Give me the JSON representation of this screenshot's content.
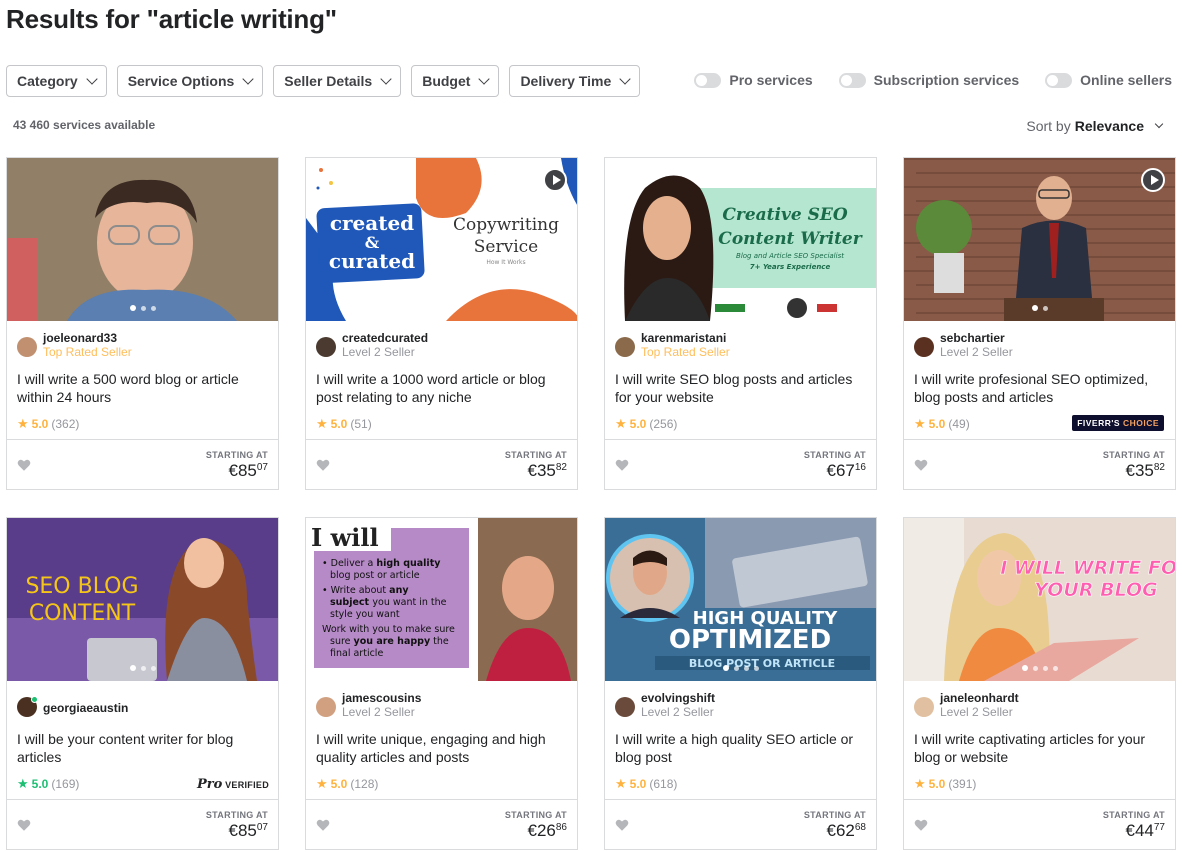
{
  "page": {
    "title": "Results for \"article writing\"",
    "count": "43 460 services available",
    "sort_label": "Sort by",
    "sort_value": "Relevance"
  },
  "filters": [
    "Category",
    "Service Options",
    "Seller Details",
    "Budget",
    "Delivery Time"
  ],
  "toggles": [
    "Pro services",
    "Subscription services",
    "Online sellers"
  ],
  "labels": {
    "starting_at": "STARTING AT",
    "currency": "€"
  },
  "gigs": [
    {
      "seller": "joeleonard33",
      "level": "Top Rated Seller",
      "level_type": "top",
      "title": "I will write a 500 word blog or article within 24 hours",
      "rating": "5.0",
      "reviews": "(362)",
      "price_main": "85",
      "price_cents": "07",
      "dots": 3,
      "active_dot": 0,
      "video": false,
      "badge": "",
      "thumb": {
        "bg": "#7a6a55",
        "accent": "#5a7fb0"
      }
    },
    {
      "seller": "createdcurated",
      "level": "Level 2 Seller",
      "level_type": "normal",
      "title": "I will write a 1000 word article or blog post relating to any niche",
      "rating": "5.0",
      "reviews": "(51)",
      "price_main": "35",
      "price_cents": "82",
      "dots": 3,
      "active_dot": 0,
      "video": true,
      "badge": "",
      "thumb": {
        "bg": "#ffffff",
        "accent": "#1f58b8",
        "text1": "created",
        "text2": "&",
        "text3": "curated",
        "text4": "Copywriting",
        "text5": "Service",
        "text6": "How It Works"
      }
    },
    {
      "seller": "karenmaristani",
      "level": "Top Rated Seller",
      "level_type": "top",
      "title": "I will write SEO blog posts and articles for your website",
      "rating": "5.0",
      "reviews": "(256)",
      "price_main": "67",
      "price_cents": "16",
      "dots": 0,
      "active_dot": 0,
      "video": false,
      "badge": "",
      "thumb": {
        "bg": "#b5e6cf",
        "accent": "#1a6b4a",
        "text1": "Creative SEO",
        "text2": "Content Writer",
        "text3": "Blog and Article SEO Specialist",
        "text4": "7+ Years Experience"
      }
    },
    {
      "seller": "sebchartier",
      "level": "Level 2 Seller",
      "level_type": "normal",
      "title": "I will write profesional SEO optimized, blog posts and articles",
      "rating": "5.0",
      "reviews": "(49)",
      "price_main": "35",
      "price_cents": "82",
      "dots": 2,
      "active_dot": 0,
      "video": true,
      "badge": "choice",
      "badge_text1": "FIVERR'S",
      "badge_text2": "CHOICE",
      "thumb": {
        "bg": "#8a5a48",
        "accent": "#2a3040"
      }
    },
    {
      "seller": "georgiaeaustin",
      "level": "",
      "level_type": "normal",
      "online": true,
      "title": "I will be your content writer for blog articles",
      "rating": "5.0",
      "reviews": "(169)",
      "price_main": "85",
      "price_cents": "07",
      "dots": 3,
      "active_dot": 0,
      "video": false,
      "badge": "pro",
      "badge_text1": "Pro",
      "badge_text2": "VERIFIED",
      "thumb": {
        "bg": "#5a3d8a",
        "accent": "#f5c518",
        "text1": "SEO BLOG",
        "text2": "CONTENT"
      }
    },
    {
      "seller": "jamescousins",
      "level": "Level 2 Seller",
      "level_type": "normal",
      "title": "I will write unique, engaging and high quality articles and posts",
      "rating": "5.0",
      "reviews": "(128)",
      "price_main": "26",
      "price_cents": "86",
      "dots": 0,
      "active_dot": 0,
      "video": false,
      "badge": "",
      "thumb": {
        "bg": "#ffffff",
        "accent": "#b58ac6",
        "text1": "I will",
        "bullets": [
          [
            "Deliver a ",
            "high quality",
            " blog post or article"
          ],
          [
            "Write about ",
            "any subject",
            " you want in the style you want"
          ],
          [
            "Work with you to make sure ",
            "you are happy",
            " the final article"
          ]
        ]
      }
    },
    {
      "seller": "evolvingshift",
      "level": "Level 2 Seller",
      "level_type": "normal",
      "title": "I will write a high quality SEO article or blog post",
      "rating": "5.0",
      "reviews": "(618)",
      "price_main": "62",
      "price_cents": "68",
      "dots": 4,
      "active_dot": 0,
      "video": false,
      "badge": "",
      "thumb": {
        "bg": "#3b6e96",
        "accent": "#ffffff",
        "text1": "HIGH QUALITY",
        "text2": "OPTIMIZED",
        "text3": "BLOG POST OR ARTICLE"
      }
    },
    {
      "seller": "janeleonhardt",
      "level": "Level 2 Seller",
      "level_type": "normal",
      "title": "I will write captivating articles for your blog or website",
      "rating": "5.0",
      "reviews": "(391)",
      "price_main": "44",
      "price_cents": "77",
      "dots": 4,
      "active_dot": 0,
      "video": false,
      "badge": "",
      "thumb": {
        "bg": "#e8dcd2",
        "accent": "#ff5fb0",
        "text1": "I WILL WRITE FOR",
        "text2": "YOUR BLOG"
      }
    }
  ]
}
